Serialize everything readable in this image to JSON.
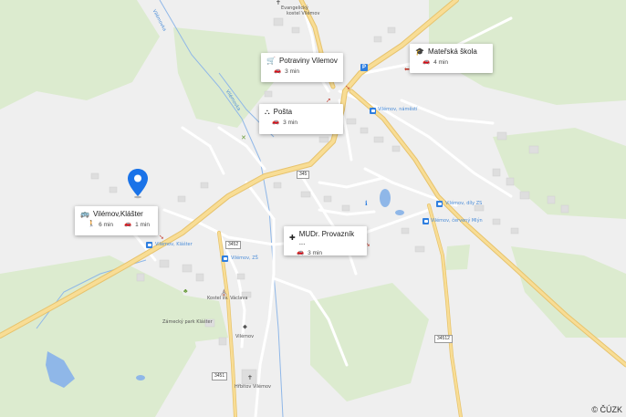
{
  "pois": [
    {
      "name": "Potraviny Vilemov",
      "icon": "cart-icon",
      "time": "3 min"
    },
    {
      "name": "Mateřská škola",
      "icon": "school-icon",
      "time": "4 min"
    },
    {
      "name": "Pošta",
      "icon": "post-icon",
      "time": "3 min"
    },
    {
      "name": "MUDr. Provazník ...",
      "icon": "medical-icon",
      "time": "3 min"
    }
  ],
  "selected_stop": {
    "name": "Vilémov,Klášter",
    "walk_time": "6 min",
    "drive_time": "1 min"
  },
  "labels": {
    "church_evangelical": "Evangelický",
    "church_evangelical2": "kostel Vilémov",
    "stop_namesti": "Vilémov, náměstí",
    "stop_dily": "Vilémov, díly ZS",
    "stop_cerveny": "Vilémov, červený Mlýn",
    "stop_klaster": "Vilémov, Klášter",
    "stop_zs": "Vilémov, ZŠ",
    "church_vaclav": "Kostel sv. Václava",
    "park": "Zámecký park Klášter",
    "cemetery": "Hřbitov Vilémov",
    "town": "Vilémov",
    "stream": "Vilémovka",
    "road_345": "345",
    "road_3452": "3452",
    "road_34512": "34512",
    "road_3451": "3451",
    "copyright": "© ČÚZK"
  },
  "colors": {
    "pin": "#1a73e8",
    "water": "#8fb7e8",
    "green": "#d4e7c5",
    "road_major": "#f6d58a",
    "bus": "#2f7fe0"
  }
}
